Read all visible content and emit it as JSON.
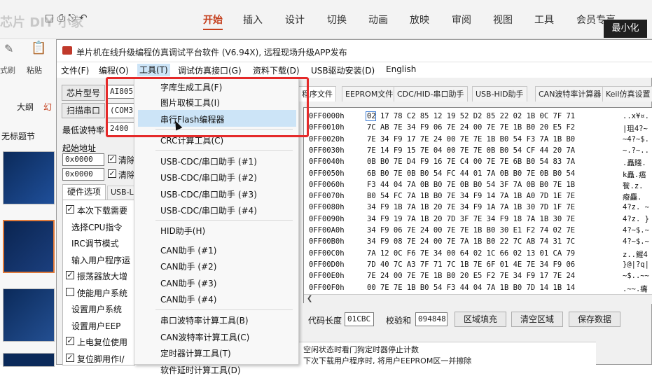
{
  "ppt": {
    "tabs": [
      "开始",
      "插入",
      "设计",
      "切换",
      "动画",
      "放映",
      "审阅",
      "视图",
      "工具",
      "会员专享"
    ],
    "watermark": "芯片 DIY 小家",
    "ribbon_left_labels": [
      "式刷",
      "粘贴"
    ],
    "outline_label": "大纲",
    "outline_label2": "幻",
    "slide_title": "无标题节",
    "minimize_tooltip": "最小化"
  },
  "window": {
    "title": "单片机在线升级编程仿真调试平台软件 (V6.94X), 远程现场升级APP发布",
    "menu": [
      "文件(F)",
      "编程(O)",
      "工具(T)",
      "调试仿真接口(G)",
      "资料下载(D)",
      "USB驱动安装(D)",
      "English"
    ]
  },
  "left_panel": {
    "chip_model_label": "芯片型号",
    "chip_model_value": "AI8051",
    "scan_port_label": "扫描串口",
    "port_value": "(COM3",
    "min_baud_label": "最低波特率",
    "min_baud_value": "2400",
    "start_addr_label": "起始地址",
    "addr1": "0x0000",
    "addr2": "0x0000",
    "clear1": "清除",
    "clear2": "清除",
    "hw_tab": "硬件选项",
    "usb_tab": "USB-L",
    "options": [
      {
        "text": "本次下载需要",
        "checked": true
      },
      {
        "text": "选择CPU指令",
        "checked": null
      },
      {
        "text": "IRC调节模式",
        "checked": null
      },
      {
        "text": "输入用户程序运",
        "checked": null
      },
      {
        "text": "振荡器放大增",
        "checked": true
      },
      {
        "text": "使能用户系统",
        "checked": false
      },
      {
        "text": "设置用户系统",
        "checked": null
      },
      {
        "text": "设置用户EEP",
        "checked": null
      },
      {
        "text": "上电复位使用",
        "checked": true
      },
      {
        "text": "复位脚用作I/",
        "checked": true
      }
    ]
  },
  "tools_menu": {
    "items": [
      "字库生成工具(F)",
      "图片取模工具(I)",
      "串行Flash编程器",
      "CRC计算工具(C)",
      "USB-CDC/串口助手 (#1)",
      "USB-CDC/串口助手 (#2)",
      "USB-CDC/串口助手 (#3)",
      "USB-CDC/串口助手 (#4)",
      "HID助手(H)",
      "CAN助手 (#1)",
      "CAN助手 (#2)",
      "CAN助手 (#3)",
      "CAN助手 (#4)",
      "串口波特率计算工具(B)",
      "CAN波特率计算工具(C)",
      "定时器计算工具(T)",
      "软件延时计算工具(D)"
    ],
    "highlighted": "串行Flash编程器"
  },
  "right_tabs": [
    "程序文件",
    "EEPROM文件",
    "CDC/HID-串口助手",
    "USB-HID助手",
    "CAN波特率计算器",
    "Keil仿真设置"
  ],
  "hex": [
    {
      "addr": "0FF0000h",
      "bytes": "02 17 78 C2 85 12 19 52 D2 85 22 02 1B 0C 7F 71",
      "ascii": "..x¥¤."
    },
    {
      "addr": "0FF0010h",
      "bytes": "7C AB 7E 34 F9 06 7E 24 00 7E 7E 1B B0 20 E5 F2",
      "ascii": "|珇4?~"
    },
    {
      "addr": "0FF0020h",
      "bytes": "7E 34 F9 17 7E 24 00 7E 7E 1B B0 54 F3 7A 1B B0",
      "ascii": "~4?~$."
    },
    {
      "addr": "0FF0030h",
      "bytes": "7E 14 F9 15 7E 04 00 7E 7E 0B B0 54 CF 44 20 7A",
      "ascii": "~.?~.."
    },
    {
      "addr": "0FF0040h",
      "bytes": "0B B0 7E D4 F9 16 7E C4 00 7E 7E 6B B0 54 83 7A",
      "ascii": ".矗賤."
    },
    {
      "addr": "0FF0050h",
      "bytes": "6B B0 7E 0B B0 54 FC 44 01 7A 0B B0 7E 0B B0 54",
      "ascii": "k矗.痦"
    },
    {
      "addr": "0FF0060h",
      "bytes": "F3 44 04 7A 0B B0 7E 0B B0 54 3F 7A 0B B0 7E 1B",
      "ascii": "餮.z."
    },
    {
      "addr": "0FF0070h",
      "bytes": "B0 54 FC 7A 1B B0 7E 34 F9 14 7A 1B A0 7D 1E 7E",
      "ascii": "癈麤."
    },
    {
      "addr": "0FF0080h",
      "bytes": "34 F9 1B 7A 1B 20 7E 34 F9 1A 7A 1B 30 7D 1F 7E",
      "ascii": "4?z. ~"
    },
    {
      "addr": "0FF0090h",
      "bytes": "34 F9 19 7A 1B 20 7D 3F 7E 34 F9 18 7A 1B 30 7E",
      "ascii": "4?z. }"
    },
    {
      "addr": "0FF00A0h",
      "bytes": "34 F9 06 7E 24 00 7E 7E 1B B0 30 E1 F2 74 02 7E",
      "ascii": "4?~$.~"
    },
    {
      "addr": "0FF00B0h",
      "bytes": "34 F9 08 7E 24 00 7E 7A 1B B0 22 7C AB 74 31 7C",
      "ascii": "4?~$.~"
    },
    {
      "addr": "0FF00C0h",
      "bytes": "7A 12 0C F6 7E 34 00 64 02 1C 66 02 13 01 CA 79",
      "ascii": "z..鯹4"
    },
    {
      "addr": "0FF00D0h",
      "bytes": "7D 40 7C A3 7F 71 7C 1B 7E 6F 01 4E 7E 34 F9 06",
      "ascii": "}@|?q|"
    },
    {
      "addr": "0FF00E0h",
      "bytes": "7E 24 00 7E 7E 1B B0 20 E5 F2 7E 34 F9 17 7E 24",
      "ascii": "~$..~~"
    },
    {
      "addr": "0FF00F0h",
      "bytes": "00 7E 7E 1B B0 54 F3 44 04 7A 1B B0 7D 14 1B 14",
      "ascii": ".~~.癟"
    }
  ],
  "bottom_bar": {
    "code_len_label": "代码长度",
    "code_len_value": "01CBC",
    "checksum_label": "校验和",
    "checksum_value": "094848",
    "fill_button": "区域填充",
    "clear_button": "清空区域",
    "save_button": "保存数据"
  },
  "log": [
    "空闲状态时看门狗定时器停止计数",
    "下次下载用户程序时, 将用户EEPROM区一并擦除"
  ]
}
